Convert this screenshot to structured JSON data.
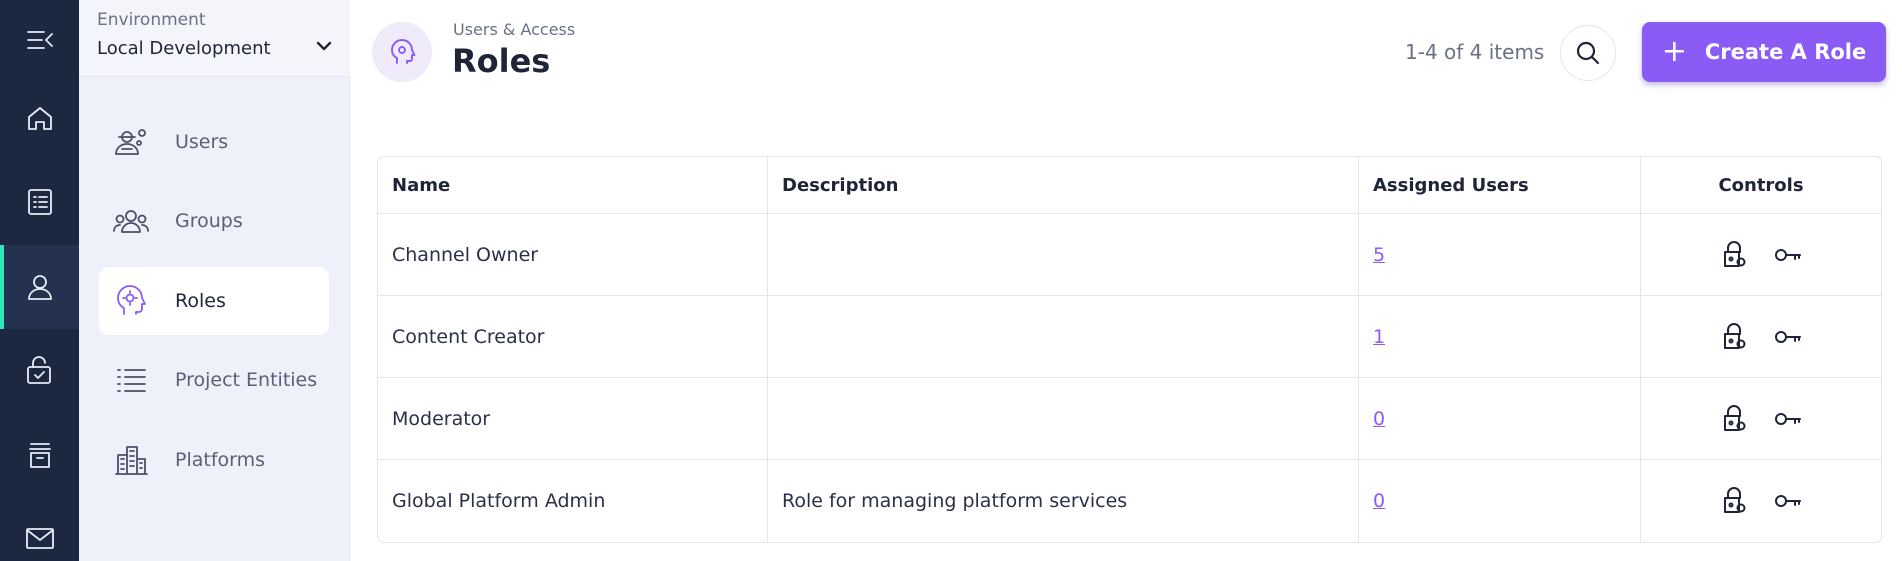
{
  "rail": {
    "items": [
      {
        "name": "collapse-menu-icon"
      },
      {
        "name": "home-icon"
      },
      {
        "name": "list-icon"
      },
      {
        "name": "user-icon"
      },
      {
        "name": "secure-task-icon"
      },
      {
        "name": "archive-icon"
      },
      {
        "name": "mail-icon"
      }
    ],
    "active_index": 3,
    "accent_color": "#2ee6b6"
  },
  "environment": {
    "label": "Environment",
    "value": "Local Development"
  },
  "sidebar": {
    "items": [
      {
        "label": "Users",
        "icon": "users-settings-icon"
      },
      {
        "label": "Groups",
        "icon": "groups-icon"
      },
      {
        "label": "Roles",
        "icon": "roles-icon",
        "active": true
      },
      {
        "label": "Project Entities",
        "icon": "list-icon"
      },
      {
        "label": "Platforms",
        "icon": "buildings-icon"
      }
    ]
  },
  "header": {
    "breadcrumb": "Users & Access",
    "title": "Roles",
    "count": "1-4 of 4 items",
    "create_label": "Create A Role",
    "brand_color": "#8a5cf5"
  },
  "table": {
    "columns": [
      "Name",
      "Description",
      "Assigned Users",
      "Controls"
    ],
    "rows": [
      {
        "name": "Channel Owner",
        "description": "",
        "assigned": "5"
      },
      {
        "name": "Content Creator",
        "description": "",
        "assigned": "1"
      },
      {
        "name": "Moderator",
        "description": "",
        "assigned": "0"
      },
      {
        "name": "Global Platform Admin",
        "description": "Role for managing platform services",
        "assigned": "0"
      }
    ]
  }
}
